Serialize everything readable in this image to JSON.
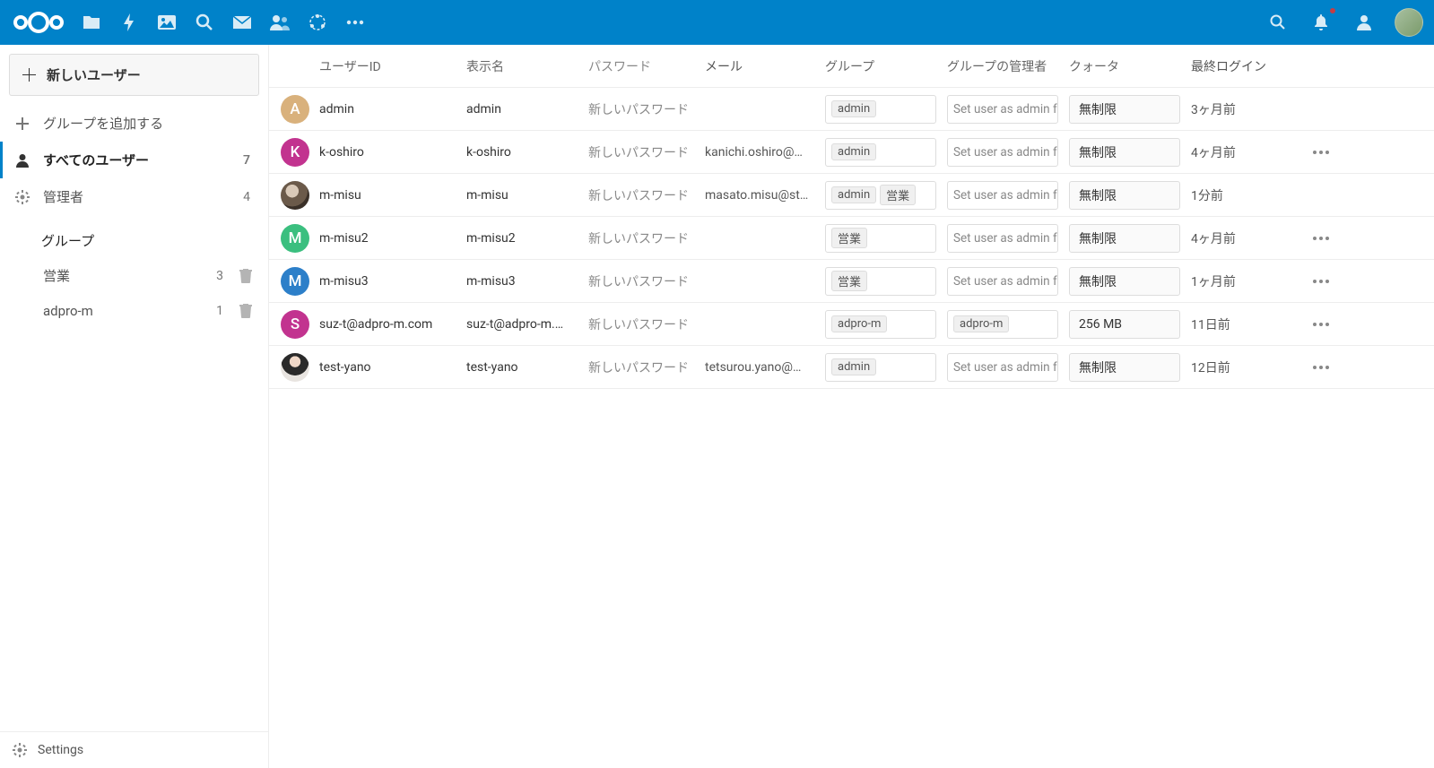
{
  "header": {
    "app_icons": [
      "files",
      "activity",
      "gallery",
      "search-global",
      "mail",
      "contacts",
      "circles",
      "more"
    ]
  },
  "sidebar": {
    "new_user": "新しいユーザー",
    "add_group": "グループを追加する",
    "all_users": "すべてのユーザー",
    "all_users_count": "7",
    "admins": "管理者",
    "admins_count": "4",
    "groups_header": "グループ",
    "groups": [
      {
        "name": "営業",
        "count": "3"
      },
      {
        "name": "adpro-m",
        "count": "1"
      }
    ],
    "settings": "Settings"
  },
  "table": {
    "headers": {
      "userid": "ユーザーID",
      "display": "表示名",
      "password": "パスワード",
      "email": "メール",
      "groups": "グループ",
      "admin": "グループの管理者",
      "quota": "クォータ",
      "last_login": "最終ログイン"
    },
    "password_placeholder": "新しいパスワード",
    "admin_placeholder": "Set user as admin fo",
    "rows": [
      {
        "avatar_letter": "A",
        "avatar_color": "#d9b17c",
        "userid": "admin",
        "display": "admin",
        "email": "",
        "groups": [
          "admin"
        ],
        "admin": "placeholder",
        "quota": "無制限",
        "last_login": "3ヶ月前",
        "actions": false
      },
      {
        "avatar_letter": "K",
        "avatar_color": "#c2338f",
        "userid": "k-oshiro",
        "display": "k-oshiro",
        "email": "kanichi.oshiro@…",
        "groups": [
          "admin"
        ],
        "admin": "placeholder",
        "quota": "無制限",
        "last_login": "4ヶ月前",
        "actions": true
      },
      {
        "avatar_letter": "",
        "avatar_color": "photo1",
        "userid": "m-misu",
        "display": "m-misu",
        "email": "masato.misu@st…",
        "groups": [
          "admin",
          "営業"
        ],
        "admin": "placeholder",
        "quota": "無制限",
        "last_login": "1分前",
        "actions": false
      },
      {
        "avatar_letter": "M",
        "avatar_color": "#3bbf7f",
        "userid": "m-misu2",
        "display": "m-misu2",
        "email": "",
        "groups": [
          "営業"
        ],
        "admin": "placeholder",
        "quota": "無制限",
        "last_login": "4ヶ月前",
        "actions": true
      },
      {
        "avatar_letter": "M",
        "avatar_color": "#2c7fc9",
        "userid": "m-misu3",
        "display": "m-misu3",
        "email": "",
        "groups": [
          "営業"
        ],
        "admin": "placeholder",
        "quota": "無制限",
        "last_login": "1ヶ月前",
        "actions": true
      },
      {
        "avatar_letter": "S",
        "avatar_color": "#c2338f",
        "userid": "suz-t@adpro-m.com",
        "display": "suz-t@adpro-m.…",
        "email": "",
        "groups": [
          "adpro-m"
        ],
        "admin": "adpro-m",
        "quota": "256 MB",
        "last_login": "11日前",
        "actions": true
      },
      {
        "avatar_letter": "",
        "avatar_color": "photo2",
        "userid": "test-yano",
        "display": "test-yano",
        "email": "tetsurou.yano@…",
        "groups": [
          "admin"
        ],
        "admin": "placeholder",
        "quota": "無制限",
        "last_login": "12日前",
        "actions": true
      }
    ]
  }
}
